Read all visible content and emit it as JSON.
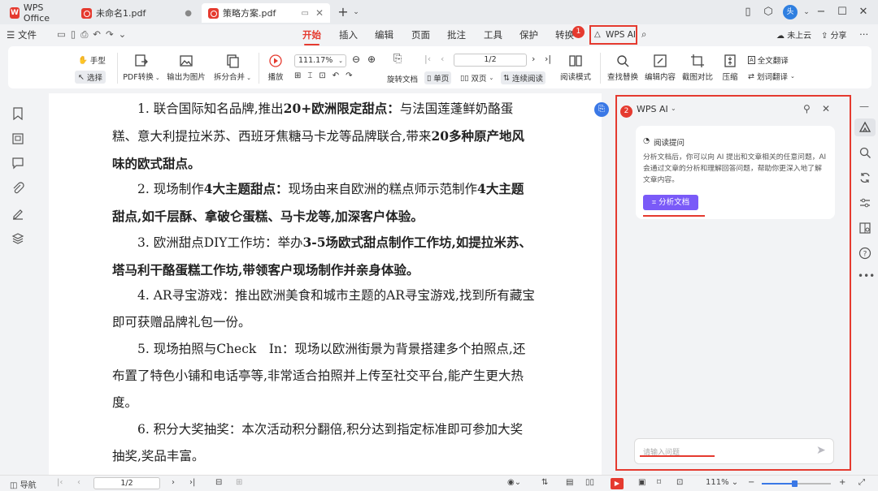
{
  "titlebar": {
    "tabs": [
      {
        "label": "WPS Office"
      },
      {
        "label": "未命名1.pdf"
      },
      {
        "label": "策略方案.pdf"
      }
    ],
    "new_tab": "+",
    "avatar_text": "头"
  },
  "menu": {
    "file": "文件",
    "items": [
      "开始",
      "插入",
      "编辑",
      "页面",
      "批注",
      "工具",
      "保护",
      "转换"
    ],
    "wps_ai": "WPS AI",
    "cloud": "未上云",
    "share": "分享"
  },
  "ribbon": {
    "hand": "手型",
    "select": "选择",
    "pdf_convert": "PDF转换",
    "export_image": "输出为图片",
    "split_merge": "拆分合并",
    "play": "播放",
    "zoom": "111.17%",
    "page": "1/2",
    "rotate": "旋转文档",
    "single": "单页",
    "double": "双页",
    "continuous": "连续阅读",
    "read_mode": "阅读模式",
    "find_replace": "查找替换",
    "edit_content": "编辑内容",
    "screenshot_compare": "截图对比",
    "compress": "压缩",
    "full_translate": "全文翻译",
    "word_translate": "划词翻译"
  },
  "document": {
    "paragraphs": [
      {
        "num": "1. ",
        "plain1": "联合国际知名品牌,推出",
        "bold1": "20+欧洲限定甜点：",
        "plain2": "与法国莲蓬鲜奶酪蛋糕、意大利提拉米苏、西班牙焦糖马卡龙等品牌联合,带来",
        "bold2": "20多种原产地风味的欧式甜点。"
      },
      {
        "num": "2. ",
        "plain1": "现场制作",
        "bold1": "4大主题甜点：",
        "plain2": "现场由来自欧洲的糕点师示范制作",
        "bold2": "4大主题甜点,如千层酥、拿破仑蛋糕、马卡龙等,加深客户体验。"
      },
      {
        "num": "3. ",
        "plain1": "欧洲甜点DIY工作坊：举办",
        "bold1": "3-5场欧式甜点制作工作坊,如提拉米苏、塔马利干酪蛋糕工作坊,带领客户现场制作并亲身体验。",
        "plain2": "",
        "bold2": ""
      },
      {
        "num": "4. ",
        "plain1": "AR寻宝游戏：推出欧洲美食和城市主题的AR寻宝游戏,找到所有藏宝即可获赠品牌礼包一份。",
        "bold1": "",
        "plain2": "",
        "bold2": ""
      },
      {
        "num": "5. ",
        "plain1": "现场拍照与Check　In：现场以欧洲街景为背景搭建多个拍照点,还布置了特色小铺和电话亭等,非常适合拍照并上传至社交平台,能产生更大热度。",
        "bold1": "",
        "plain2": "",
        "bold2": ""
      },
      {
        "num": "6. ",
        "plain1": "积分大奖抽奖：本次活动积分翻倍,积分达到指定标准即可参加大奖抽奖,奖品丰富。",
        "bold1": "",
        "plain2": "",
        "bold2": ""
      }
    ]
  },
  "ai_panel": {
    "title": "WPS AI",
    "card_title": "阅读提问",
    "card_desc": "分析文档后，你可以向 AI 提出和文章相关的任意问题，AI 会通过文章的分析和理解回答问题，帮助你更深入地了解文章内容。",
    "analyze_button": "分析文档",
    "input_placeholder": "请输入问题"
  },
  "annotations": {
    "badge1": "1",
    "badge2": "2"
  },
  "statusbar": {
    "nav": "导航",
    "page": "1/2",
    "zoom": "111%"
  },
  "colors": {
    "accent": "#e53a2f",
    "ai_purple": "#7a5af8"
  }
}
